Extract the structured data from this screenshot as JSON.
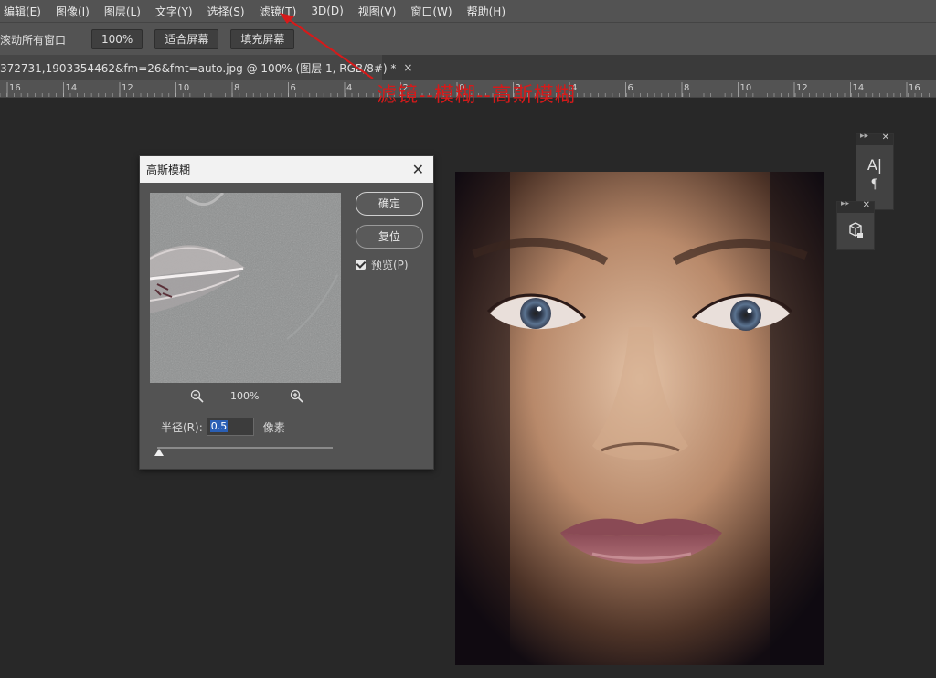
{
  "menu": [
    "编辑(E)",
    "图像(I)",
    "图层(L)",
    "文字(Y)",
    "选择(S)",
    "滤镜(T)",
    "3D(D)",
    "视图(V)",
    "窗口(W)",
    "帮助(H)"
  ],
  "options": {
    "scroll_all": "滚动所有窗口",
    "zoom_100": "100%",
    "fit_screen": "适合屏幕",
    "fill_screen": "填充屏幕"
  },
  "doc_tab": {
    "title": "372731,1903354462&fm=26&fmt=auto.jpg @ 100% (图层 1, RGB/8#) *",
    "close": "×"
  },
  "ruler_labels": [
    "16",
    "14",
    "12",
    "10",
    "8",
    "6",
    "4",
    "2",
    "0",
    "2",
    "4",
    "6",
    "8",
    "10",
    "12",
    "14",
    "16"
  ],
  "annotation": "滤镜--模糊--高斯模糊",
  "dialog": {
    "title": "高斯模糊",
    "ok": "确定",
    "reset": "复位",
    "preview_label": "预览(P)",
    "preview_checked": true,
    "zoom": "100%",
    "radius_label": "半径(R):",
    "radius_value": "0.5",
    "unit": "像素"
  },
  "panels": {
    "type_icon": "A|",
    "para_icon": "¶"
  },
  "colors": {
    "annotation": "#d61a1a",
    "selection": "#2a5fb5"
  }
}
